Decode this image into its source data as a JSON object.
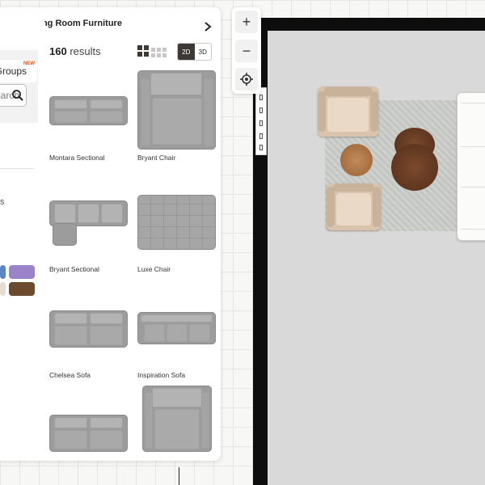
{
  "panel": {
    "title": "Living Room Furniture",
    "results_count": "160",
    "results_label": "results",
    "view_2d": "2D",
    "view_3d": "3D",
    "active_view": "2D"
  },
  "left": {
    "groups_label": "Groups",
    "new_badge": "NEW",
    "search_placeholder": "Search furniture",
    "stub_text": "s"
  },
  "swatches": [
    "#5b86c4",
    "#9b83c9",
    "#e5ddd0",
    "#6b4a2e"
  ],
  "products": [
    {
      "name": "Montara Sectional"
    },
    {
      "name": "Bryant Chair"
    },
    {
      "name": "Bryant Sectional"
    },
    {
      "name": "Luxe Chair"
    },
    {
      "name": "Chelsea Sofa"
    },
    {
      "name": "Inspiration Sofa"
    },
    {
      "name": ""
    },
    {
      "name": ""
    }
  ],
  "map": {
    "zoom_in": "+",
    "zoom_out": "−"
  },
  "colors": {
    "wall": "#0d0d0d",
    "floor": "#d9d9d9",
    "toggle_active": "#3d3a36",
    "new_badge": "#e0561f"
  }
}
